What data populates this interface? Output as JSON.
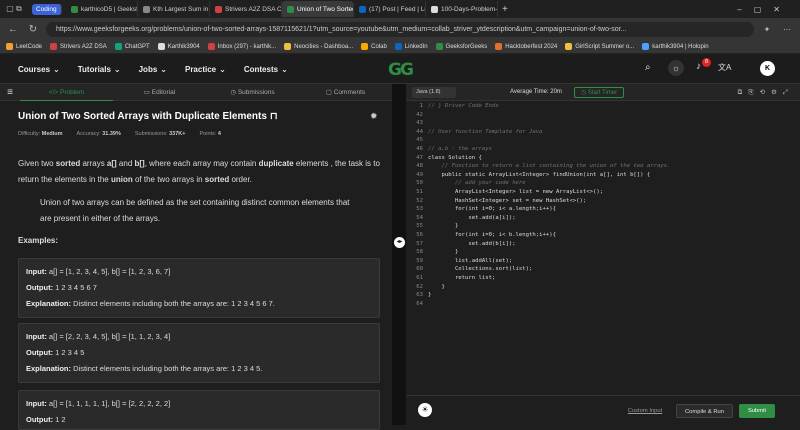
{
  "browser": {
    "tabs": [
      {
        "label": "Coding",
        "color": "#3b62d6",
        "active": false
      },
      {
        "label": "karthicoD5 | GeeksforGe",
        "color": "#2f8d46",
        "active": false
      },
      {
        "label": "Kth Largest Sum in a Bi",
        "color": "#888888",
        "active": false
      },
      {
        "label": "Strivers A2Z DSA Cours",
        "color": "#d04040",
        "active": false
      },
      {
        "label": "Union of Two Sorted A",
        "color": "#2f8d46",
        "active": true
      },
      {
        "label": "(17) Post | Feed | Linke",
        "color": "#0a66c2",
        "active": false
      },
      {
        "label": "100-Days-Problem-Solv",
        "color": "#dddddd",
        "active": false
      }
    ],
    "url": "https://www.geeksforgeeks.org/problems/union-of-two-sorted-arrays-1587115621/1?utm_source=youtube&utm_medium=collab_striver_ytdescription&utm_campaign=union-of-two-sor...",
    "bookmarks": [
      "LeetCode",
      "Strivers A2Z DSA",
      "ChatGPT",
      "Karthik3904",
      "Inbox (297) - karthik...",
      "Neocities - Dashboa...",
      "Colab",
      "LinkedIn",
      "GeeksforGeeks",
      "Hacktoberfest 2024",
      "GirlScript Summer o...",
      "karthik3904 | Holopin"
    ]
  },
  "site": {
    "nav": [
      "Courses",
      "Tutorials",
      "Jobs",
      "Practice",
      "Contests"
    ],
    "logo_text": "GG",
    "notification_count": "8",
    "avatar_letter": "K"
  },
  "problem": {
    "tabs": [
      "Problem",
      "Editorial",
      "Submissions",
      "Comments"
    ],
    "title": "Union of Two Sorted Arrays with Duplicate Elements",
    "difficulty_label": "Difficulty:",
    "difficulty": "Medium",
    "accuracy_label": "Accuracy:",
    "accuracy": "31.39%",
    "submissions_label": "Submissions:",
    "submissions": "337K+",
    "points_label": "Points:",
    "points": "4",
    "desc_1": "Given two ",
    "desc_sorted": "sorted",
    "desc_2": " arrays ",
    "desc_a": "a[]",
    "desc_3": " and ",
    "desc_b": "b[]",
    "desc_4": ", where each array may contain ",
    "desc_dup": "duplicate",
    "desc_5": " elements , the task is to return the elements in the ",
    "desc_union": "union",
    "desc_6": " of the two arrays in ",
    "desc_sorted2": "sorted",
    "desc_7": " order.",
    "definition": "Union of two arrays can be defined as the set containing distinct common elements that are present in either of the arrays.",
    "examples_label": "Examples:",
    "examples": [
      {
        "input": "a[] = [1, 2, 3, 4, 5], b[] = [1, 2, 3, 6, 7]",
        "output": "1 2 3 4 5 6 7",
        "explanation": "Distinct elements including both the arrays are: 1 2 3 4 5 6 7."
      },
      {
        "input": "a[] = [2, 2, 3, 4, 5], b[] = [1, 1, 2, 3, 4]",
        "output": "1 2 3 4 5",
        "explanation": "Distinct elements including both the arrays are: 1 2 3 4 5."
      },
      {
        "input": "a[] = [1, 1, 1, 1, 1], b[] = [2, 2, 2, 2, 2]",
        "output": "1 2",
        "explanation": ""
      }
    ],
    "input_label": "Input:",
    "output_label": "Output:",
    "explanation_label": "Explanation:"
  },
  "editor": {
    "language": "Java (1.8)",
    "avg_time_label": "Average Time:",
    "avg_time": "20m",
    "start_timer": "Start Timer",
    "lines": [
      {
        "n": "1",
        "t": "// } Driver Code Ends",
        "c": "#6a737d"
      },
      {
        "n": "42",
        "t": "",
        "c": "#ddd"
      },
      {
        "n": "43",
        "t": "",
        "c": "#ddd"
      },
      {
        "n": "44",
        "t": "// User function Template for Java",
        "c": "#6a737d"
      },
      {
        "n": "45",
        "t": "",
        "c": "#ddd"
      },
      {
        "n": "46",
        "t": "// a,b : the arrays",
        "c": "#6a737d"
      },
      {
        "n": "47",
        "t": "class Solution {",
        "c": "#ddd"
      },
      {
        "n": "48",
        "t": "    // Function to return a list containing the union of the two arrays.",
        "c": "#6a737d"
      },
      {
        "n": "49",
        "t": "    public static ArrayList<Integer> findUnion(int a[], int b[]) {",
        "c": "#ddd"
      },
      {
        "n": "50",
        "t": "        // add your code here",
        "c": "#6a737d"
      },
      {
        "n": "51",
        "t": "        ArrayList<Integer> list = new ArrayList<>();",
        "c": "#ddd"
      },
      {
        "n": "52",
        "t": "        HashSet<Integer> set = new HashSet<>();",
        "c": "#ddd"
      },
      {
        "n": "53",
        "t": "        for(int i=0; i< a.length;i++){",
        "c": "#ddd"
      },
      {
        "n": "54",
        "t": "            set.add(a[i]);",
        "c": "#ddd"
      },
      {
        "n": "55",
        "t": "        }",
        "c": "#ddd"
      },
      {
        "n": "56",
        "t": "        for(int i=0; i< b.length;i++){",
        "c": "#ddd"
      },
      {
        "n": "57",
        "t": "            set.add(b[i]);",
        "c": "#ddd"
      },
      {
        "n": "58",
        "t": "        }",
        "c": "#ddd"
      },
      {
        "n": "59",
        "t": "        list.addAll(set);",
        "c": "#ddd"
      },
      {
        "n": "60",
        "t": "        Collections.sort(list);",
        "c": "#ddd"
      },
      {
        "n": "61",
        "t": "        return list;",
        "c": "#ddd"
      },
      {
        "n": "62",
        "t": "    }",
        "c": "#ddd"
      },
      {
        "n": "63",
        "t": "}",
        "c": "#ddd"
      },
      {
        "n": "64",
        "t": "",
        "c": "#ddd"
      }
    ],
    "custom_input": "Custom Input",
    "compile_run": "Compile & Run",
    "submit": "Submit"
  },
  "colors": {
    "brand": "#2f8d46",
    "bg": "#1e1e1e",
    "accent_red": "#e02424"
  }
}
